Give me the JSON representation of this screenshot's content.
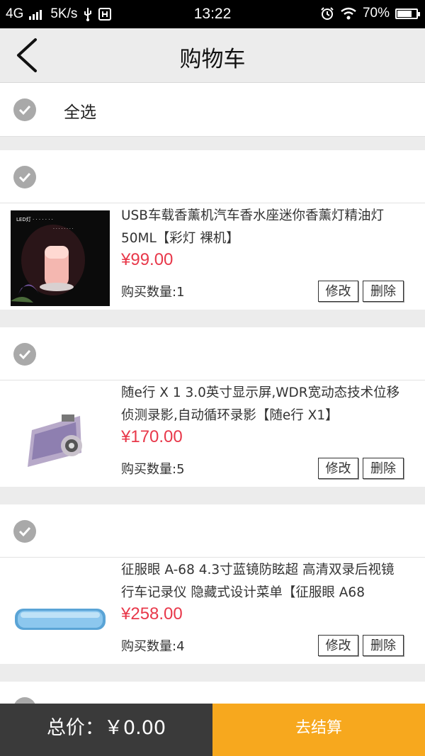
{
  "status": {
    "network": "4G",
    "speed": "5K/s",
    "time": "13:22",
    "battery": "70%"
  },
  "header": {
    "title": "购物车"
  },
  "select_all": {
    "label": "全选"
  },
  "items": [
    {
      "name": "USB车载香薰机汽车香水座迷你香薰灯精油灯 50ML【彩灯 裸机】",
      "price": "¥99.00",
      "quantity": "购买数量:1",
      "edit_label": "修改",
      "delete_label": "删除",
      "image": "aroma-diffuser-image"
    },
    {
      "name": "随e行 X 1 3.0英寸显示屏,WDR宽动态技术位移侦测录影,自动循环录影【随e行 X1】",
      "price": "¥170.00",
      "quantity": "购买数量:5",
      "edit_label": "修改",
      "delete_label": "删除",
      "image": "dashcam-image"
    },
    {
      "name": "征服眼 A-68 4.3寸蓝镜防眩超 高清双录后视镜行车记录仪 隐藏式设计菜单【征服眼 A68",
      "price": "¥258.00",
      "quantity": "购买数量:4",
      "edit_label": "修改",
      "delete_label": "删除",
      "image": "mirror-recorder-image"
    }
  ],
  "footer": {
    "total_label": "总价：￥0.00",
    "checkout_label": "去结算"
  },
  "colors": {
    "price": "#e8384a",
    "checkout": "#f7a81e",
    "total_bg": "#3a3a3a",
    "check": "#a9a9a9"
  }
}
